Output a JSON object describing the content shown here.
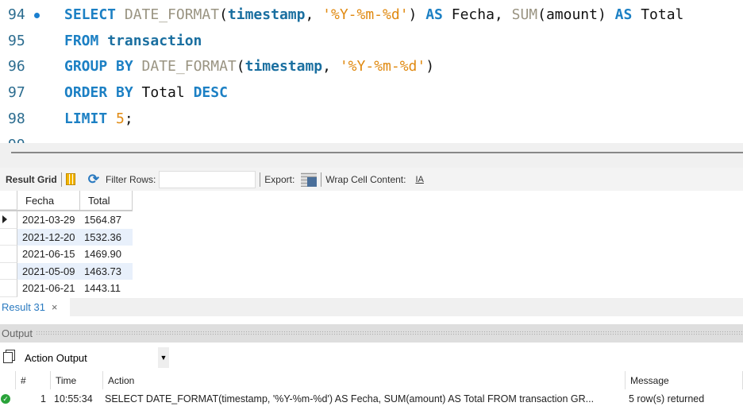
{
  "editor": {
    "lines": [
      {
        "num": "94",
        "marker": true,
        "tokens": [
          [
            "kw",
            "SELECT "
          ],
          [
            "fn",
            "DATE_FORMAT"
          ],
          [
            "plain",
            "("
          ],
          [
            "id",
            "timestamp"
          ],
          [
            "plain",
            ", "
          ],
          [
            "str",
            "'%Y-%m-%d'"
          ],
          [
            "plain",
            ") "
          ],
          [
            "kw",
            "AS"
          ],
          [
            "plain",
            " Fecha, "
          ],
          [
            "fn",
            "SUM"
          ],
          [
            "plain",
            "(amount) "
          ],
          [
            "kw",
            "AS"
          ],
          [
            "plain",
            " Total"
          ]
        ]
      },
      {
        "num": "95",
        "tokens": [
          [
            "kw",
            "FROM "
          ],
          [
            "id",
            "transaction"
          ]
        ]
      },
      {
        "num": "96",
        "tokens": [
          [
            "kw",
            "GROUP BY "
          ],
          [
            "fn",
            "DATE_FORMAT"
          ],
          [
            "plain",
            "("
          ],
          [
            "id",
            "timestamp"
          ],
          [
            "plain",
            ", "
          ],
          [
            "str",
            "'%Y-%m-%d'"
          ],
          [
            "plain",
            ")"
          ]
        ]
      },
      {
        "num": "97",
        "tokens": [
          [
            "kw",
            "ORDER BY "
          ],
          [
            "plain",
            "Total "
          ],
          [
            "kw",
            "DESC"
          ]
        ]
      },
      {
        "num": "98",
        "tokens": [
          [
            "kw",
            "LIMIT "
          ],
          [
            "num",
            "5"
          ],
          [
            "plain",
            ";"
          ]
        ]
      },
      {
        "num": "99",
        "tokens": []
      }
    ]
  },
  "toolbar": {
    "result_grid": "Result Grid",
    "filter_rows": "Filter Rows:",
    "filter_value": "",
    "export": "Export:",
    "wrap": "Wrap Cell Content:",
    "wrap_icon": "IA"
  },
  "grid": {
    "columns": [
      "Fecha",
      "Total"
    ],
    "rows": [
      [
        "2021-03-29",
        "1564.87"
      ],
      [
        "2021-12-20",
        "1532.36"
      ],
      [
        "2021-06-15",
        "1469.90"
      ],
      [
        "2021-05-09",
        "1463.73"
      ],
      [
        "2021-06-21",
        "1443.11"
      ]
    ]
  },
  "result_tab": {
    "label": "Result 31",
    "close": "×"
  },
  "output": {
    "title": "Output",
    "selector": "Action Output",
    "columns": [
      "#",
      "Time",
      "Action",
      "Message"
    ],
    "rows": [
      {
        "num": "1",
        "time": "10:55:34",
        "action": "SELECT DATE_FORMAT(timestamp, '%Y-%m-%d') AS Fecha, SUM(amount) AS Total FROM transaction GR...",
        "message": "5 row(s) returned",
        "status": "success"
      }
    ]
  }
}
